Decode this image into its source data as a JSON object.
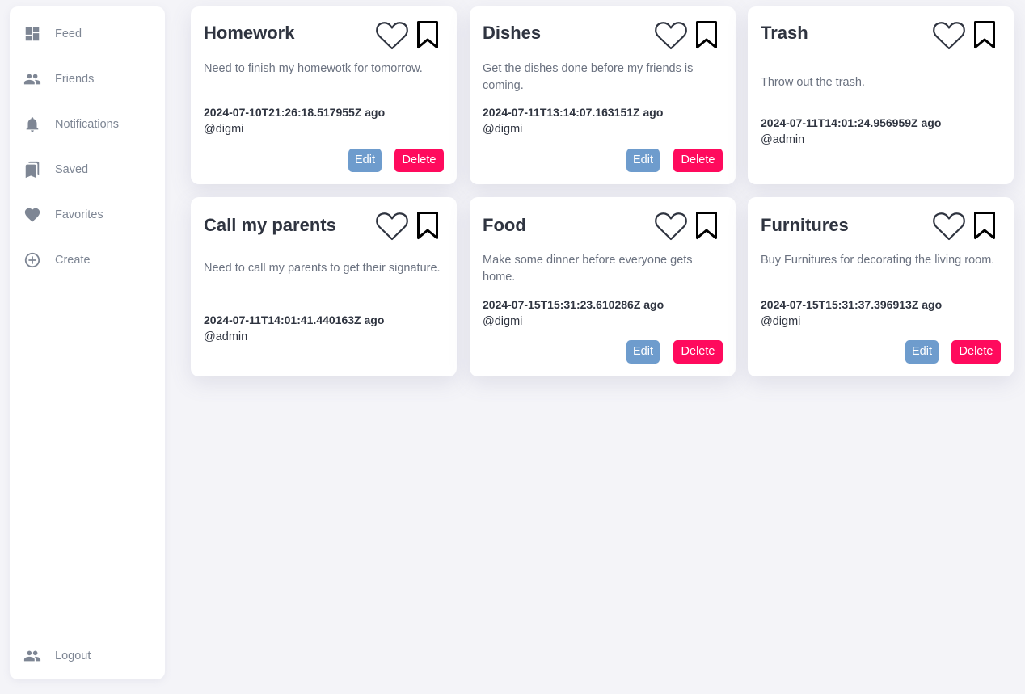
{
  "sidebar": {
    "items": [
      {
        "label": "Feed",
        "icon": "dashboard-icon"
      },
      {
        "label": "Friends",
        "icon": "people-icon"
      },
      {
        "label": "Notifications",
        "icon": "bell-icon"
      },
      {
        "label": "Saved",
        "icon": "bookmarks-icon"
      },
      {
        "label": "Favorites",
        "icon": "heart-icon"
      },
      {
        "label": "Create",
        "icon": "plus-circle-icon"
      }
    ],
    "logout": {
      "label": "Logout",
      "icon": "people-icon"
    }
  },
  "cards": [
    {
      "title": "Homework",
      "description": "Need to finish my homewotk for tomorrow.",
      "time": "2024-07-10T21:26:18.517955Z ago",
      "user": "@digmi",
      "edit_label": "Edit",
      "delete_label": "Delete"
    },
    {
      "title": "Dishes",
      "description": "Get the dishes done before my friends is coming.",
      "time": "2024-07-11T13:14:07.163151Z ago",
      "user": "@digmi",
      "edit_label": "Edit",
      "delete_label": "Delete"
    },
    {
      "title": "Trash",
      "description": "Throw out the trash.",
      "time": "2024-07-11T14:01:24.956959Z ago",
      "user": "@admin"
    },
    {
      "title": "Call my parents",
      "description": "Need to call my parents to get their signature.",
      "time": "2024-07-11T14:01:41.440163Z ago",
      "user": "@admin"
    },
    {
      "title": "Food",
      "description": "Make some dinner before everyone gets home.",
      "time": "2024-07-15T15:31:23.610286Z ago",
      "user": "@digmi",
      "edit_label": "Edit",
      "delete_label": "Delete"
    },
    {
      "title": "Furnitures",
      "description": "Buy Furnitures for decorating the living room.",
      "time": "2024-07-15T15:31:37.396913Z ago",
      "user": "@digmi",
      "edit_label": "Edit",
      "delete_label": "Delete"
    }
  ],
  "colors": {
    "background": "#f4f4f8",
    "card": "#ffffff",
    "nav_text": "#7e8694",
    "edit_button": "#6e9ccd",
    "delete_button": "#ff0a5d"
  }
}
